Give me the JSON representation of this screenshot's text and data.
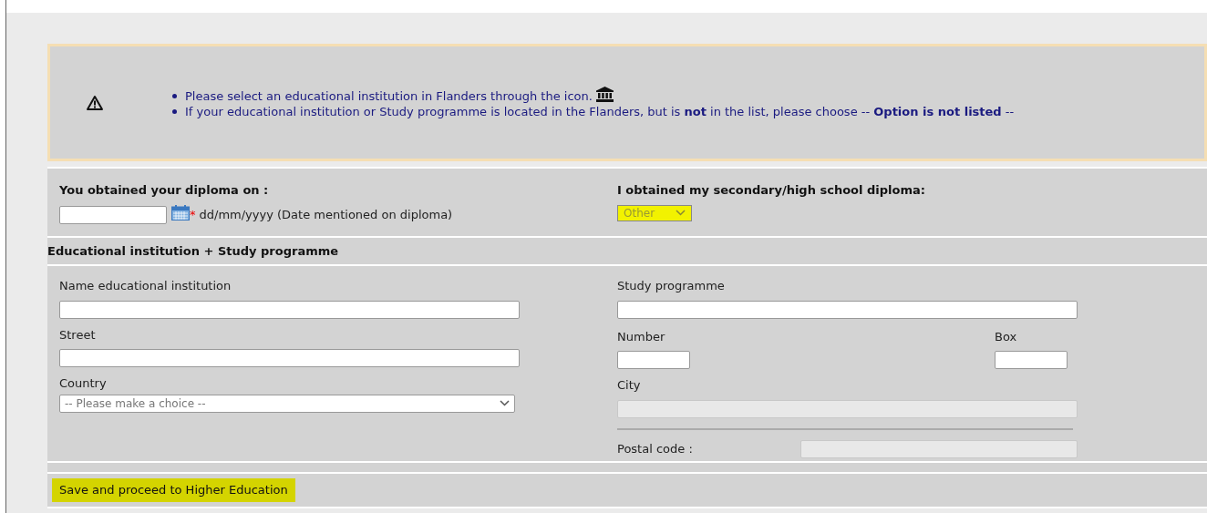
{
  "notice": {
    "items": [
      "Please select an educational institution in Flanders through the icon.",
      "If your educational institution or Study programme is located in the Flanders, but is **not** in the list, please choose -- **Option is not listed** --"
    ]
  },
  "diploma_date": {
    "label": "You obtained your diploma on :",
    "required_mark": "*",
    "hint": "dd/mm/yyyy (Date mentioned on diploma)"
  },
  "secondary_diploma": {
    "label": "I obtained my secondary/high school diploma:",
    "value": "Other",
    "highlighted": true
  },
  "section_title": "Educational institution + Study programme",
  "left_fields": [
    {
      "kind": "text",
      "label": "Name educational institution",
      "disabled": false
    },
    {
      "kind": "text",
      "label": "Street",
      "disabled": false
    },
    {
      "kind": "select",
      "label": "Country",
      "placeholder": "-- Please make a choice --",
      "disabled": false
    }
  ],
  "right_fields": {
    "study_programme": {
      "label": "Study programme",
      "disabled": false
    },
    "number": {
      "label": "Number",
      "disabled": false
    },
    "box": {
      "label": "Box",
      "disabled": false
    },
    "city": {
      "label": "City",
      "disabled": true
    },
    "postal_code": {
      "label": "Postal code :",
      "disabled": true
    }
  },
  "save_button": {
    "label": "Save and proceed to Higher Education",
    "highlighted": true
  }
}
